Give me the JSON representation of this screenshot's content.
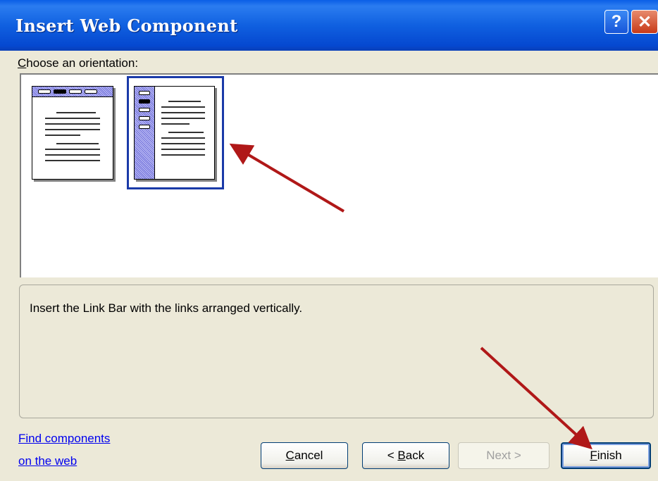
{
  "window": {
    "title": "Insert Web Component"
  },
  "titlebar_buttons": {
    "help": "?",
    "close": "✕"
  },
  "prompt": {
    "prefix": "",
    "mnemonic": "C",
    "rest": "hoose an orientation:"
  },
  "options": [
    {
      "name": "horizontal-orientation",
      "selected": false
    },
    {
      "name": "vertical-orientation",
      "selected": true
    }
  ],
  "description": "Insert the Link Bar with the links arranged vertically.",
  "find_link": {
    "line1": "Find components",
    "line2": "on the web"
  },
  "buttons": {
    "cancel": {
      "mnemonic": "C",
      "rest": "ancel"
    },
    "back": {
      "prefix": "< ",
      "mnemonic": "B",
      "rest": "ack"
    },
    "next": "Next >",
    "finish": {
      "mnemonic": "F",
      "rest": "inish"
    }
  },
  "colors": {
    "annotation_arrow": "#b01818",
    "selection_border": "#1a3aa8"
  }
}
